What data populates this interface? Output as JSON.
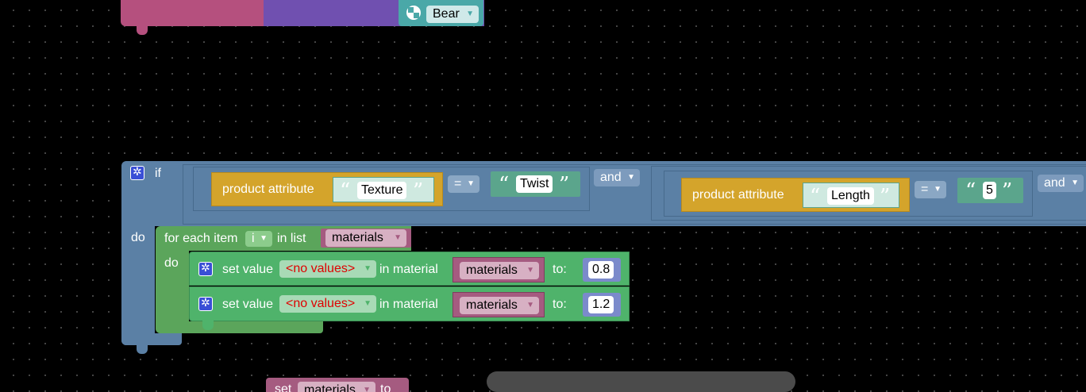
{
  "top_block": {
    "field_text": "Bear"
  },
  "if_block": {
    "if_label": "if",
    "do_label": "do",
    "and_ops": [
      "and",
      "and"
    ],
    "conditions": [
      {
        "attr_label": "product attribute",
        "attr_value": "Texture",
        "op": "=",
        "value": "Twist"
      },
      {
        "attr_label": "product attribute",
        "attr_value": "Length",
        "op": "=",
        "value": "5"
      }
    ]
  },
  "for_each": {
    "label": "for each item",
    "var": "i",
    "in_list_label": "in list",
    "list": "materials",
    "do_label": "do"
  },
  "set_values": [
    {
      "label": "set value",
      "field": "<no values>",
      "in_material_label": "in material",
      "material": "materials",
      "to_label": "to:",
      "value": "0.8"
    },
    {
      "label": "set value",
      "field": "<no values>",
      "in_material_label": "in material",
      "material": "materials",
      "to_label": "to:",
      "value": "1.2"
    }
  ],
  "bottom_block": {
    "label_set": "set",
    "var": "materials",
    "label_to": "to"
  },
  "colors": {
    "if_blue": "#5b80a5",
    "for_green": "#5ba55b",
    "set_green": "#4fb36b",
    "attr_yellow": "#d4a42b",
    "text_teal": "#5ba58c",
    "var_pink": "#a55b80",
    "purple": "#7050b0",
    "pink_top": "#b5507e",
    "error_red": "#e00000"
  }
}
